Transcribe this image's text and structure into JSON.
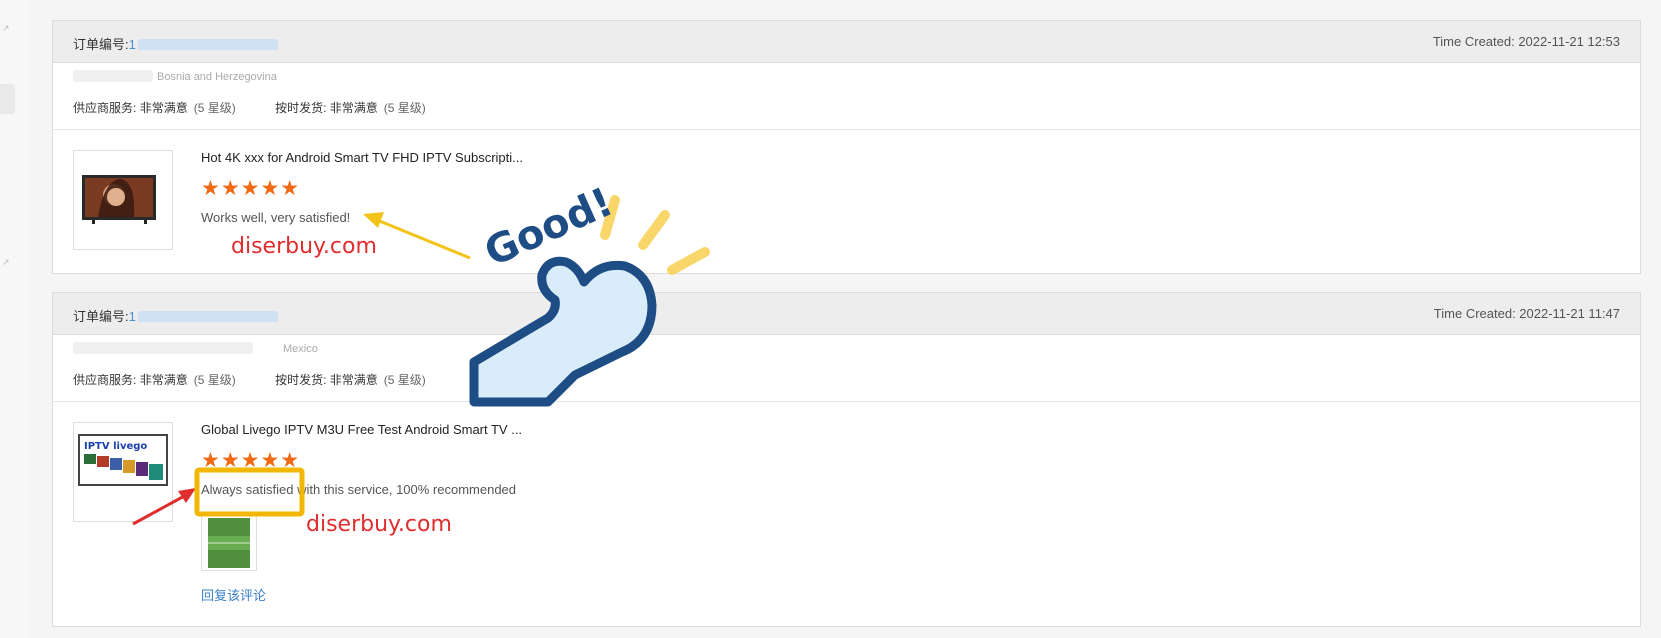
{
  "orders": [
    {
      "order_label": "订单编号:",
      "order_prefix": "1",
      "time_created": "Time Created: 2022-11-21 12:53",
      "buyer_location": "Bosnia and Herzegovina",
      "supplier_service_label": "供应商服务:",
      "supplier_service_value": "非常满意",
      "supplier_service_stars": "(5 星级)",
      "on_time_label": "按时发货:",
      "on_time_value": "非常满意",
      "on_time_stars": "(5 星级)",
      "product_title": "Hot 4K xxx for Android Smart TV FHD IPTV Subscripti...",
      "rating": 5,
      "stars_text": "★★★★★",
      "review_text": "Works well, very satisfied!",
      "watermark": "diserbuy.com"
    },
    {
      "order_label": "订单编号:",
      "order_prefix": "1",
      "time_created": "Time Created: 2022-11-21 11:47",
      "buyer_location": "Mexico",
      "supplier_service_label": "供应商服务:",
      "supplier_service_value": "非常满意",
      "supplier_service_stars": "(5 星级)",
      "on_time_label": "按时发货:",
      "on_time_value": "非常满意",
      "on_time_stars": "(5 星级)",
      "product_title": "Global Livego IPTV M3U Free Test Android Smart TV ...",
      "rating": 5,
      "stars_text": "★★★★★",
      "review_text": "Always satisfied with this service, 100% recommended",
      "watermark": "diserbuy.com",
      "reply_link": "回复该评论",
      "thumb_brand": "IPTV   livego"
    }
  ],
  "overlay": {
    "good_text": "Good!",
    "colors": {
      "hand_outline": "#1e4d85",
      "hand_fill": "#d8ecfa",
      "rays": "#f9d66a",
      "arrow_yellow": "#f2c318",
      "arrow_red": "#e02d2d",
      "highlight_box": "#f2b705"
    }
  },
  "colors": {
    "star": "#ef6a13",
    "link": "#3a7fc8",
    "watermark": "#e02d2d",
    "header_bg": "#ededed"
  }
}
